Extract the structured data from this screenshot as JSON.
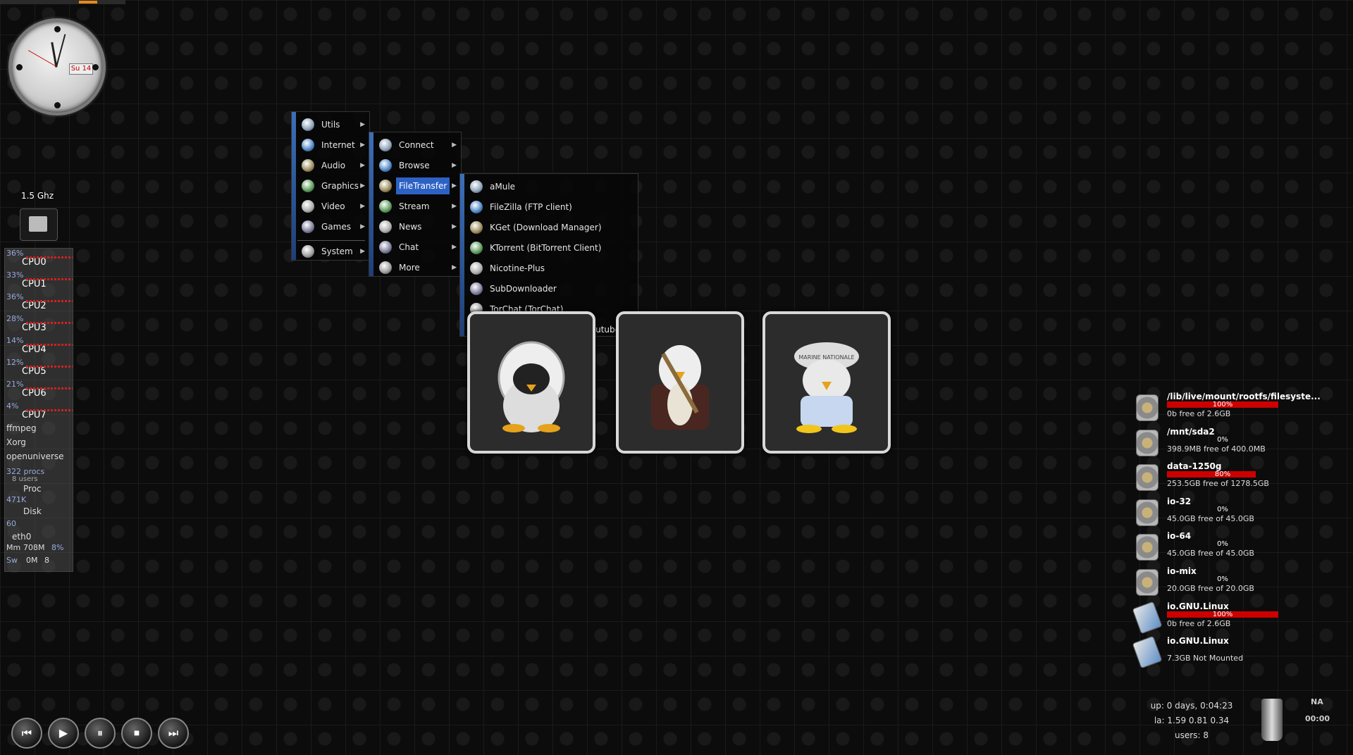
{
  "clock": {
    "date_label": "Su 14"
  },
  "cpu_widget": {
    "freq": "1.5 Ghz",
    "cores": [
      {
        "label": "CPU0",
        "pct": "36%"
      },
      {
        "label": "CPU1",
        "pct": "33%"
      },
      {
        "label": "CPU2",
        "pct": "36%"
      },
      {
        "label": "CPU3",
        "pct": "28%"
      },
      {
        "label": "CPU4",
        "pct": "14%"
      },
      {
        "label": "CPU5",
        "pct": "12%"
      },
      {
        "label": "CPU6",
        "pct": "21%"
      },
      {
        "label": "CPU7",
        "pct": "4%"
      }
    ],
    "processes": [
      "ffmpeg",
      "Xorg",
      "openuniverse"
    ],
    "procs_count": "322 procs",
    "users": "8 users",
    "proc_label": "Proc",
    "load_value": "471K",
    "disk_label": "Disk",
    "disk_value": "60",
    "net_label": "eth0",
    "mem_label": "Mm",
    "mem_value": "708M",
    "mem_pct": "8%",
    "swap_label": "Sw",
    "swap_value": "0M",
    "swap_pct": "8"
  },
  "menu": {
    "main": [
      {
        "label": "Utils",
        "icon": "utils-icon"
      },
      {
        "label": "Internet",
        "icon": "globe-icon"
      },
      {
        "label": "Audio",
        "icon": "audio-icon"
      },
      {
        "label": "Graphics",
        "icon": "graphics-icon"
      },
      {
        "label": "Video",
        "icon": "video-icon"
      },
      {
        "label": "Games",
        "icon": "games-icon"
      },
      {
        "label": "System",
        "icon": "system-icon"
      }
    ],
    "internet_sub": [
      {
        "label": "Connect"
      },
      {
        "label": "Browse"
      },
      {
        "label": "FileTransfer"
      },
      {
        "label": "Stream"
      },
      {
        "label": "News"
      },
      {
        "label": "Chat"
      },
      {
        "label": "More"
      }
    ],
    "filetransfer_sub": [
      {
        "label": "aMule"
      },
      {
        "label": "FileZilla (FTP client)"
      },
      {
        "label": "KGet (Download Manager)"
      },
      {
        "label": "KTorrent (BitTorrent Client)"
      },
      {
        "label": "Nicotine-Plus"
      },
      {
        "label": "SubDownloader"
      },
      {
        "label": "TorChat (TorChat)"
      },
      {
        "label": "Tribler (P2P /Bittorrent/Youtube client)"
      }
    ]
  },
  "avatars": [
    {
      "name": "Astronaut Tux"
    },
    {
      "name": "Lumberjack Tux"
    },
    {
      "name": "Sailor Tux",
      "hat_text": "MARINE NATIONALE"
    }
  ],
  "disks": [
    {
      "name": "/lib/live/mount/rootfs/filesyste...",
      "pct": "100%",
      "fill": 1.0,
      "free": "0b free of 2.6GB",
      "type": "hdd"
    },
    {
      "name": "/mnt/sda2",
      "pct": "0%",
      "fill": 0.0,
      "free": "398.9MB free of 400.0MB",
      "type": "hdd"
    },
    {
      "name": "data-1250g",
      "pct": "80%",
      "fill": 0.8,
      "free": "253.5GB free of 1278.5GB",
      "type": "hdd"
    },
    {
      "name": "io-32",
      "pct": "0%",
      "fill": 0.0,
      "free": "45.0GB free of 45.0GB",
      "type": "hdd"
    },
    {
      "name": "io-64",
      "pct": "0%",
      "fill": 0.0,
      "free": "45.0GB free of 45.0GB",
      "type": "hdd"
    },
    {
      "name": "io-mix",
      "pct": "0%",
      "fill": 0.0,
      "free": "20.0GB free of 20.0GB",
      "type": "hdd"
    },
    {
      "name": "io.GNU.Linux",
      "pct": "100%",
      "fill": 1.0,
      "free": "0b free of 2.6GB",
      "type": "usb"
    },
    {
      "name": "io.GNU.Linux",
      "pct": "",
      "fill": 0.0,
      "free": "7.3GB Not Mounted",
      "type": "usb"
    }
  ],
  "uptime": {
    "up": "up: 0 days, 0:04:23",
    "load": "la: 1.59 0.81 0.34",
    "users": "users: 8"
  },
  "weather": {
    "na": "NA",
    "time": "00:00"
  },
  "media": {
    "prev": "⏮",
    "play": "▶",
    "pause": "⏸",
    "stop": "⏹",
    "next": "⏭"
  },
  "colors": {
    "accent": "#e58a1e",
    "menu_highlight": "#2d62c5",
    "usage_bar": "#c00"
  }
}
